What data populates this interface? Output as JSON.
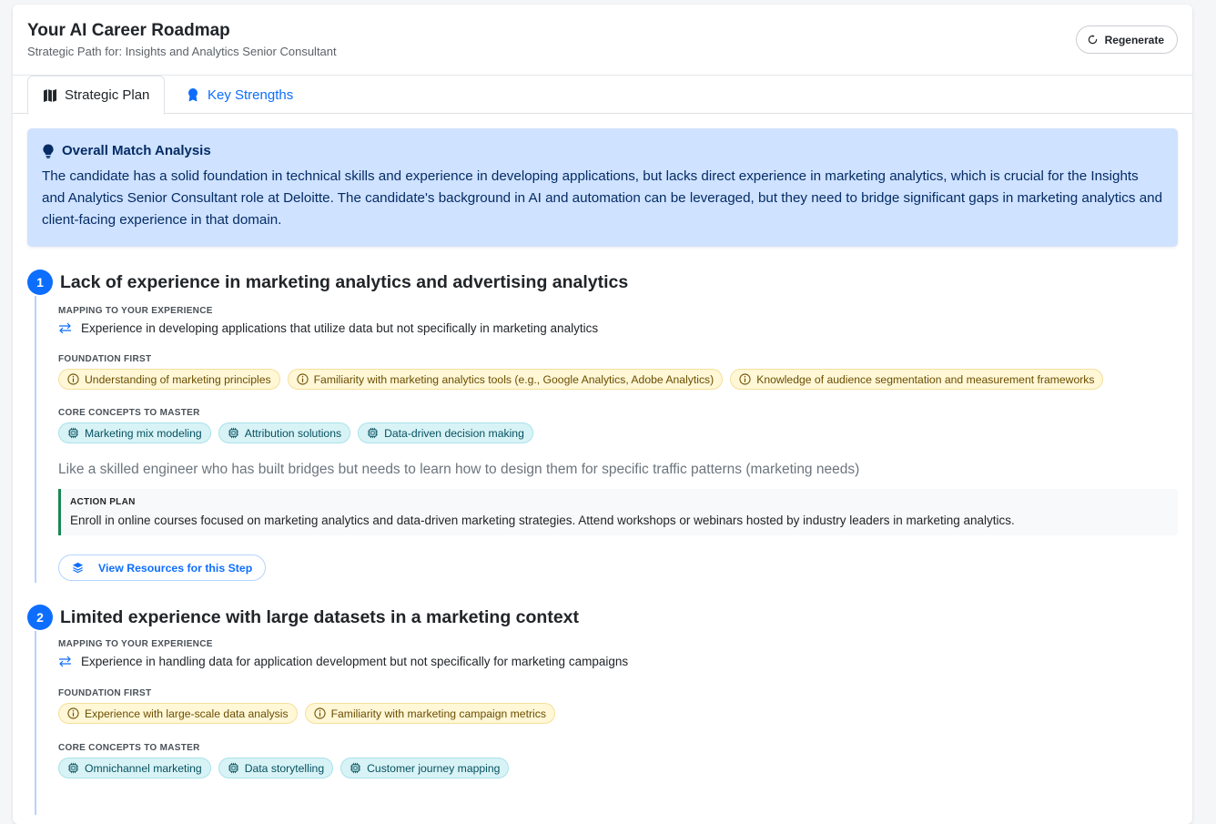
{
  "header": {
    "title": "Your AI Career Roadmap",
    "subtitle": "Strategic Path for: Insights and Analytics Senior Consultant",
    "regenerate_label": "Regenerate"
  },
  "tabs": [
    {
      "label": "Strategic Plan",
      "icon": "map-icon",
      "active": true
    },
    {
      "label": "Key Strengths",
      "icon": "award-icon",
      "active": false
    }
  ],
  "analysis": {
    "heading": "Overall Match Analysis",
    "text": "The candidate has a solid foundation in technical skills and experience in developing applications, but lacks direct experience in marketing analytics, which is crucial for the Insights and Analytics Senior Consultant role at Deloitte. The candidate's background in AI and automation can be leveraged, but they need to bridge significant gaps in marketing analytics and client-facing experience in that domain."
  },
  "labels": {
    "mapping": "MAPPING TO YOUR EXPERIENCE",
    "foundation": "FOUNDATION FIRST",
    "core": "CORE CONCEPTS TO MASTER",
    "action": "ACTION PLAN",
    "resources_button": "View Resources for this Step"
  },
  "steps": [
    {
      "number": "1",
      "title": "Lack of experience in marketing analytics and advertising analytics",
      "mapping": "Experience in developing applications that utilize data but not specifically in marketing analytics",
      "foundation": [
        "Understanding of marketing principles",
        "Familiarity with marketing analytics tools (e.g., Google Analytics, Adobe Analytics)",
        "Knowledge of audience segmentation and measurement frameworks"
      ],
      "core": [
        "Marketing mix modeling",
        "Attribution solutions",
        "Data-driven decision making"
      ],
      "analogy": "Like a skilled engineer who has built bridges but needs to learn how to design them for specific traffic patterns (marketing needs)",
      "action": "Enroll in online courses focused on marketing analytics and data-driven marketing strategies. Attend workshops or webinars hosted by industry leaders in marketing analytics."
    },
    {
      "number": "2",
      "title": "Limited experience with large datasets in a marketing context",
      "mapping": "Experience in handling data for application development but not specifically for marketing campaigns",
      "foundation": [
        "Experience with large-scale data analysis",
        "Familiarity with marketing campaign metrics"
      ],
      "core": [
        "Omnichannel marketing",
        "Data storytelling",
        "Customer journey mapping"
      ]
    }
  ],
  "colors": {
    "primary": "#0d6efd",
    "analysis_bg": "#cfe2ff",
    "foundation_chip_bg": "#fff7d6",
    "core_chip_bg": "#d8f3f6",
    "action_border": "#198754"
  }
}
